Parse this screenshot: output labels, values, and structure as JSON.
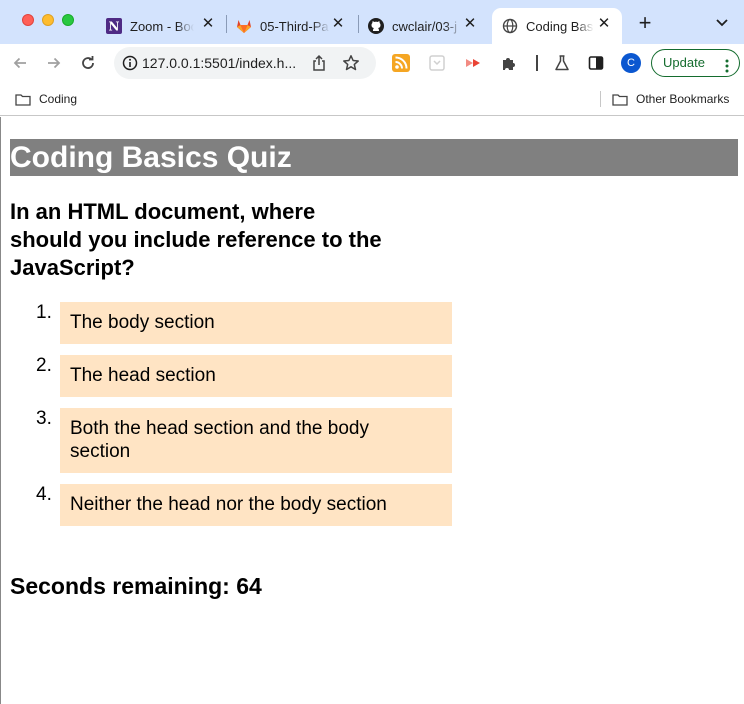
{
  "browser": {
    "tabs": [
      {
        "title": "Zoom - Boo",
        "favicon": "northwestern-n-icon"
      },
      {
        "title": "05-Third-Pa",
        "favicon": "gitlab-icon"
      },
      {
        "title": "cwclair/03-j",
        "favicon": "github-icon"
      },
      {
        "title": "Coding Basi",
        "favicon": "globe-icon",
        "active": true
      }
    ],
    "url": "127.0.0.1:5501/index.h...",
    "profile_initial": "C",
    "update_label": "Update",
    "bookmarks": [
      {
        "label": "Coding"
      }
    ],
    "other_bookmarks_label": "Other Bookmarks",
    "colors": {
      "tabstrip": "#d3e3fd",
      "update_green": "#146c2e",
      "avatar_blue": "#0b57d0"
    }
  },
  "quiz": {
    "title": "Coding Basics Quiz",
    "question": "In an HTML document, where should you include reference to the JavaScript?",
    "answers": [
      {
        "number": "1.",
        "text": "The body section"
      },
      {
        "number": "2.",
        "text": "The head section"
      },
      {
        "number": "3.",
        "text": "Both the head section and the body section"
      },
      {
        "number": "4.",
        "text": "Neither the head nor the body section"
      }
    ],
    "timer_label": "Seconds remaining: 64",
    "colors": {
      "title_bar": "#808080",
      "answer_bg": "#ffe4c4"
    }
  }
}
